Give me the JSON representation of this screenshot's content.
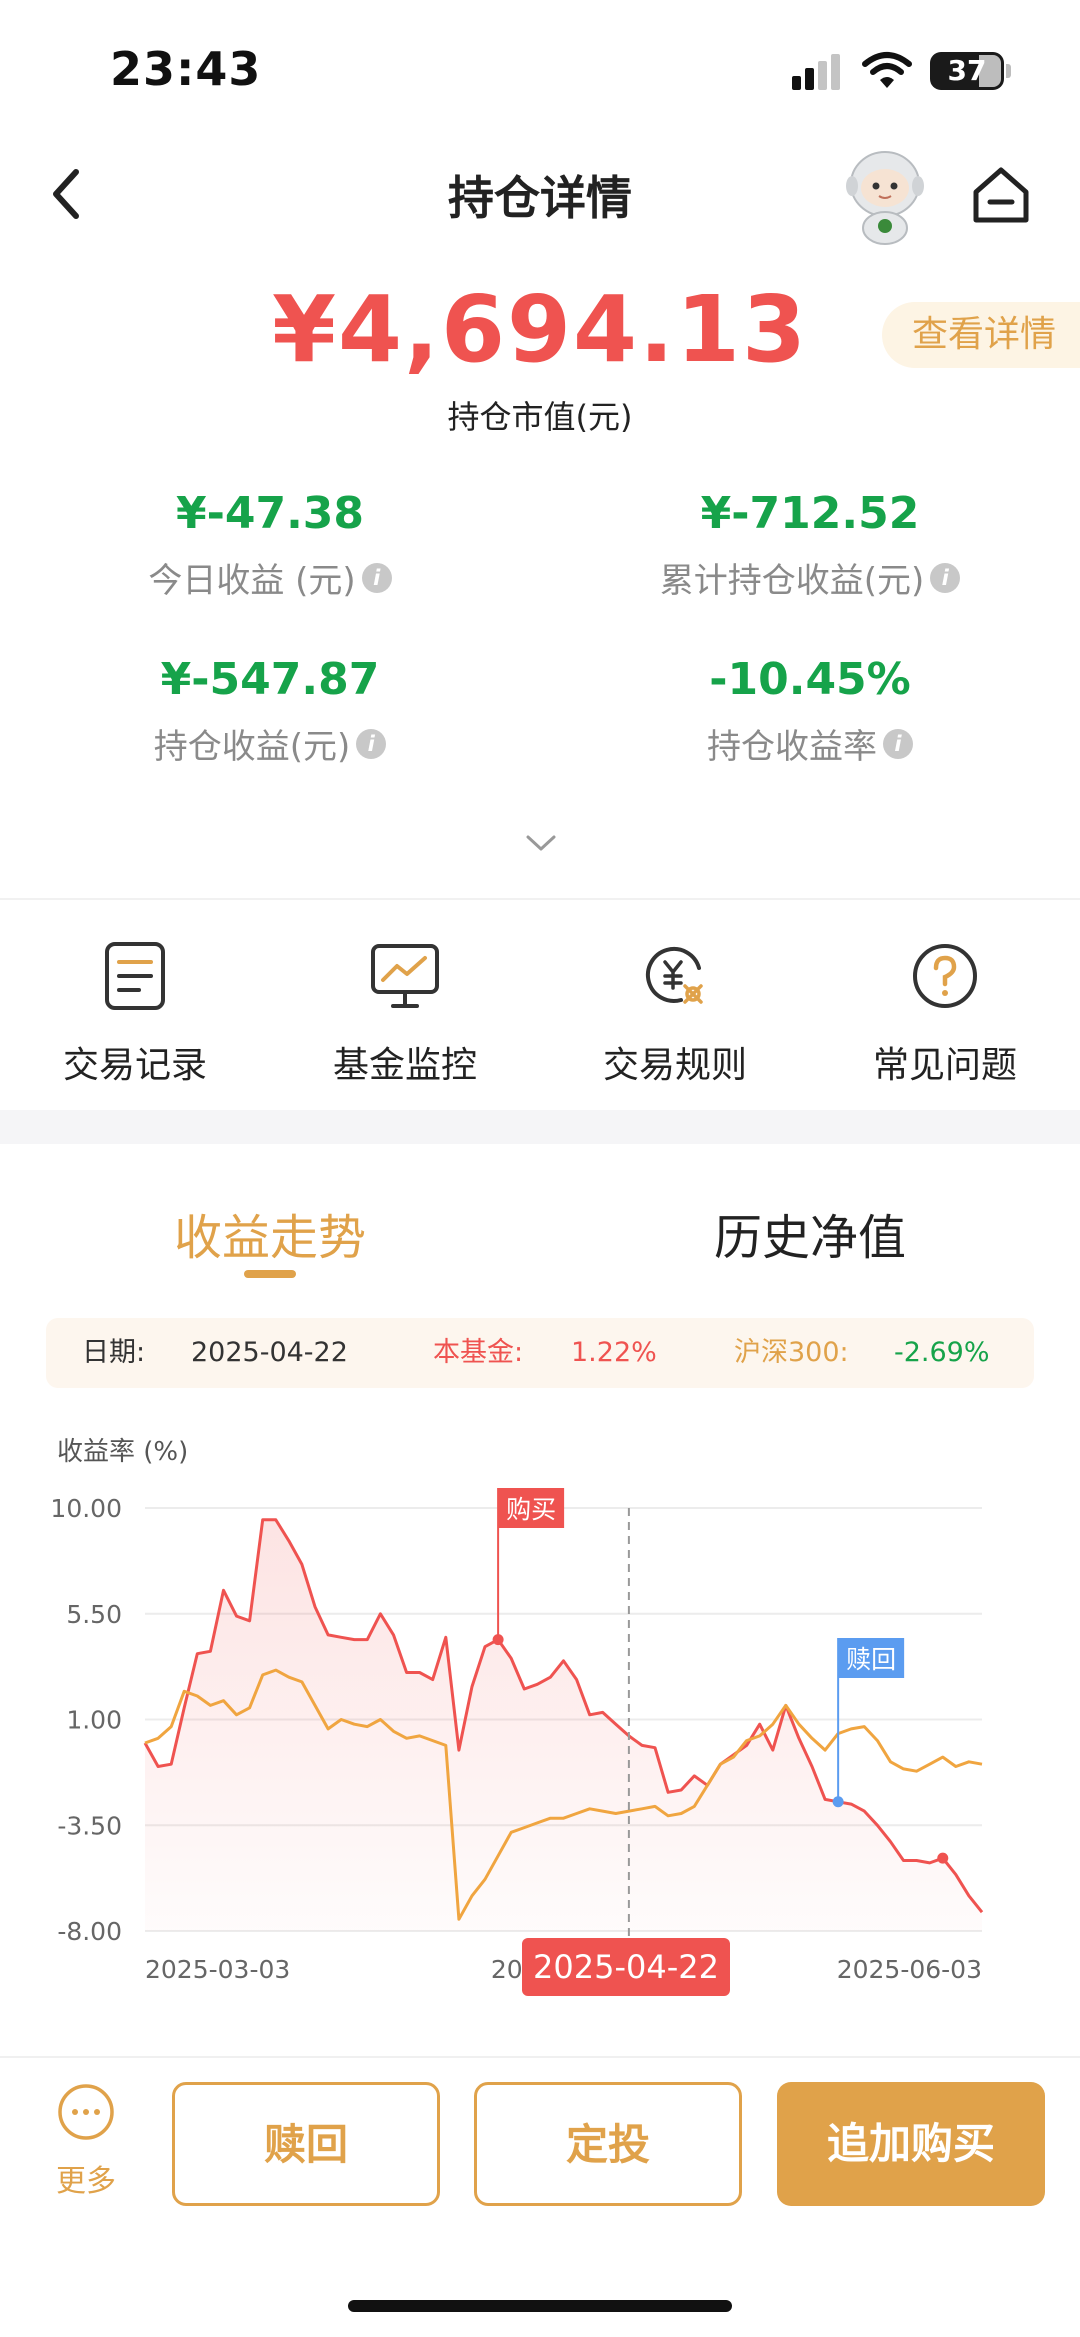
{
  "status_bar": {
    "time": "23:43",
    "battery": "37"
  },
  "nav": {
    "title": "持仓详情",
    "icons": [
      "back-arrow-icon",
      "mascot-robot-icon",
      "home-icon"
    ]
  },
  "hero": {
    "value": "¥4,694.13",
    "label": "持仓市值(元)",
    "detail_button": "查看详情"
  },
  "stats": [
    {
      "value": "¥-47.38",
      "label": "今日收益 (元)"
    },
    {
      "value": "¥-712.52",
      "label": "累计持仓收益(元)"
    },
    {
      "value": "¥-547.87",
      "label": "持仓收益(元)"
    },
    {
      "value": "-10.45%",
      "label": "持仓收益率"
    }
  ],
  "menu": [
    {
      "label": "交易记录",
      "icon": "document-icon"
    },
    {
      "label": "基金监控",
      "icon": "monitor-chart-icon"
    },
    {
      "label": "交易规则",
      "icon": "yuan-exchange-icon"
    },
    {
      "label": "常见问题",
      "icon": "question-icon"
    }
  ],
  "tabs": {
    "active": "收益走势",
    "inactive": "历史净值"
  },
  "info_bar": {
    "date_label": "日期:",
    "date_value": "2025-04-22",
    "fund_label": "本基金:",
    "fund_value": "1.22%",
    "index_label": "沪深300:",
    "index_value": "-2.69%"
  },
  "chart_data": {
    "type": "line",
    "ylabel": "收益率 (%)",
    "ylim": [
      -8.0,
      10.0
    ],
    "yticks": [
      "10.00",
      "5.50",
      "1.00",
      "-3.50",
      "-8.00"
    ],
    "xtick_labels": [
      "2025-03-03",
      "2025-04-22",
      "2025-06-03"
    ],
    "grid": true,
    "n_points": 65,
    "series": [
      {
        "color": "#ef5350",
        "area": true,
        "values": [
          0.0,
          -1.0,
          -0.9,
          1.5,
          3.8,
          3.9,
          6.5,
          5.4,
          5.2,
          9.5,
          9.5,
          8.6,
          7.6,
          5.8,
          4.6,
          4.5,
          4.4,
          4.4,
          5.5,
          4.6,
          3.0,
          3.0,
          2.7,
          4.5,
          -0.3,
          2.4,
          4.1,
          4.4,
          3.6,
          2.3,
          2.5,
          2.8,
          3.5,
          2.7,
          1.2,
          1.3,
          0.8,
          0.3,
          -0.1,
          -0.2,
          -2.1,
          -2.0,
          -1.4,
          -1.8,
          -0.9,
          -0.5,
          -0.1,
          0.8,
          -0.3,
          1.6,
          0.2,
          -1.0,
          -2.4,
          -2.5,
          -2.6,
          -2.9,
          -3.5,
          -4.2,
          -5.0,
          -5.0,
          -5.1,
          -4.9,
          -5.6,
          -6.5,
          -7.2
        ],
        "marker_index": 61
      },
      {
        "color": "#f0a540",
        "area": false,
        "values": [
          0.0,
          0.2,
          0.7,
          2.2,
          2.0,
          1.6,
          1.8,
          1.2,
          1.5,
          2.9,
          3.1,
          2.8,
          2.6,
          1.6,
          0.6,
          1.0,
          0.8,
          0.7,
          1.0,
          0.5,
          0.2,
          0.3,
          0.1,
          -0.1,
          -7.5,
          -6.5,
          -5.8,
          -4.8,
          -3.8,
          -3.6,
          -3.4,
          -3.2,
          -3.2,
          -3.0,
          -2.8,
          -2.9,
          -3.0,
          -2.9,
          -2.8,
          -2.7,
          -3.1,
          -3.0,
          -2.7,
          -1.8,
          -0.9,
          -0.6,
          0.1,
          0.3,
          0.8,
          1.6,
          0.8,
          0.2,
          -0.3,
          0.4,
          0.6,
          0.7,
          0.1,
          -0.8,
          -1.1,
          -1.2,
          -0.9,
          -0.6,
          -1.0,
          -0.8,
          -0.9
        ]
      }
    ],
    "buy_index": 27,
    "buy_label": "购买",
    "redeem_index": 53,
    "redeem_label": "赎回",
    "cursor_index": 37,
    "cursor_date": "2025-04-22"
  },
  "bottom_bar": {
    "more_label": "更多",
    "redeem_label": "赎回",
    "sip_label": "定投",
    "buy_label": "追加购买"
  }
}
